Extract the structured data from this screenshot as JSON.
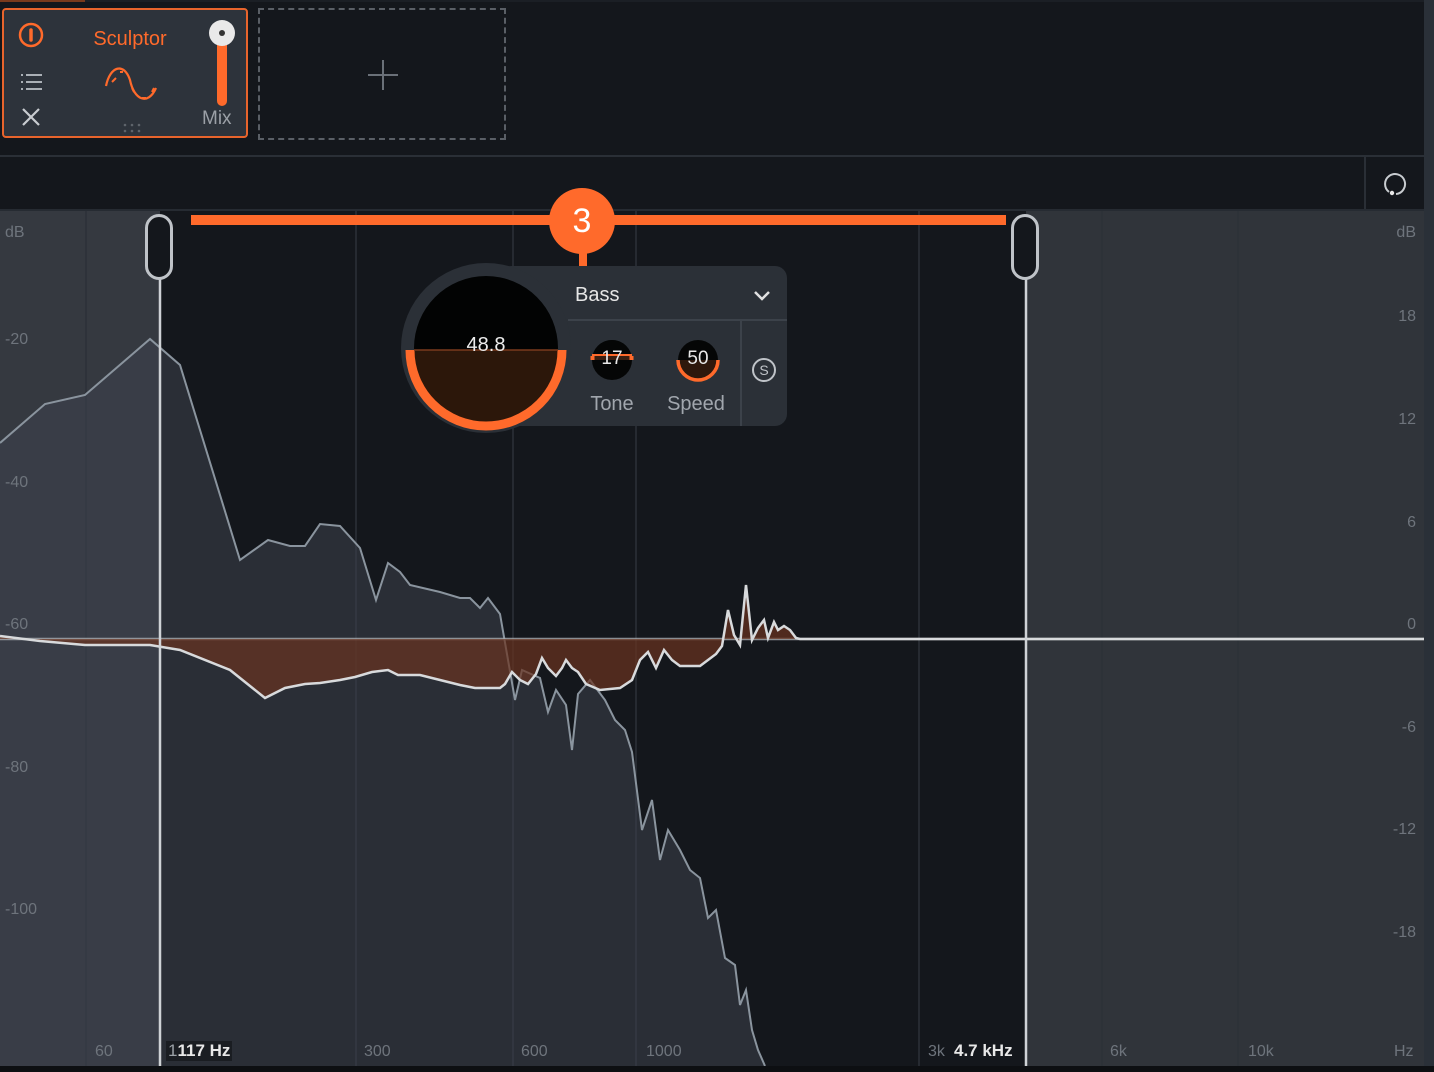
{
  "module_rack": {
    "modules": [
      {
        "name": "Sculptor",
        "mix_label": "Mix",
        "mix_fraction": 1.0,
        "icons": [
          "power-icon",
          "list-icon",
          "close-icon",
          "sculptor-wave-icon",
          "drag-grip-icon"
        ]
      }
    ],
    "add_slot_icon": "plus-icon"
  },
  "toolbar": {
    "refresh_icon": "refresh-icon"
  },
  "analyzer": {
    "left_axis": {
      "unit": "dB",
      "ticks": [
        "-20",
        "-40",
        "-60",
        "-80",
        "-100"
      ]
    },
    "right_axis": {
      "unit": "dB",
      "ticks": [
        "18",
        "12",
        "6",
        "0",
        "-6",
        "-12",
        "-18"
      ]
    },
    "freq_axis": {
      "unit": "Hz",
      "ticks": [
        "60",
        "300",
        "600",
        "1000",
        "3k",
        "6k",
        "10k"
      ]
    },
    "band": {
      "number": "3",
      "low_freq_label": "117 Hz",
      "high_freq_label": "4.7 kHz",
      "low_prefix": "1",
      "high_prefix": "3k"
    },
    "panel": {
      "type": "Bass",
      "amount": "48.8",
      "amount_fraction": 0.5,
      "tone_label": "Tone",
      "tone_value": "17",
      "tone_fraction": 0.17,
      "speed_label": "Speed",
      "speed_value": "50",
      "speed_fraction": 0.5,
      "solo_icon": "solo-icon",
      "dropdown_icon": "chevron-down-icon"
    },
    "colors": {
      "accent": "#ff6a2b",
      "spectrum_line": "#8a949e",
      "curve_line": "#d8dadc",
      "gain_fill": "#6a3320"
    }
  }
}
